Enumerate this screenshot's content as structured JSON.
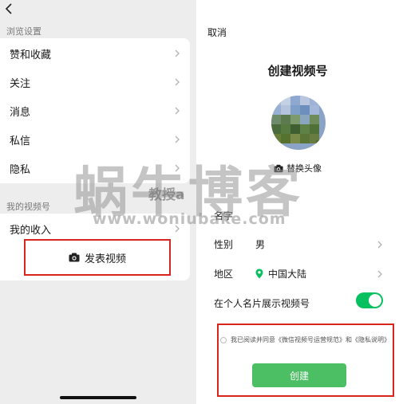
{
  "left": {
    "section1_title": "浏览设置",
    "menu": [
      {
        "label": "赞和收藏"
      },
      {
        "label": "关注"
      },
      {
        "label": "消息"
      },
      {
        "label": "私信"
      },
      {
        "label": "隐私"
      }
    ],
    "section2_title": "我的视频号",
    "income_label": "我的收入",
    "publish_label": "发表视频"
  },
  "right": {
    "cancel_label": "取消",
    "title": "创建视频号",
    "replace_avatar_label": "替换头像",
    "name_label": "名字",
    "gender_label": "性别",
    "gender_value": "男",
    "region_label": "地区",
    "region_value": "中国大陆",
    "show_on_card_label": "在个人名片展示视频号",
    "show_on_card_enabled": true,
    "agreement_text": "我已阅读并同意《微信视频号运营规范》和《隐私说明》",
    "create_label": "创建"
  },
  "watermark": {
    "big": "蜗牛博客",
    "sub": "教授a",
    "url": "www.woniubake.com"
  },
  "colors": {
    "accent_green": "#07c160",
    "button_green": "#4cbe64",
    "highlight_red": "#d9251d"
  }
}
